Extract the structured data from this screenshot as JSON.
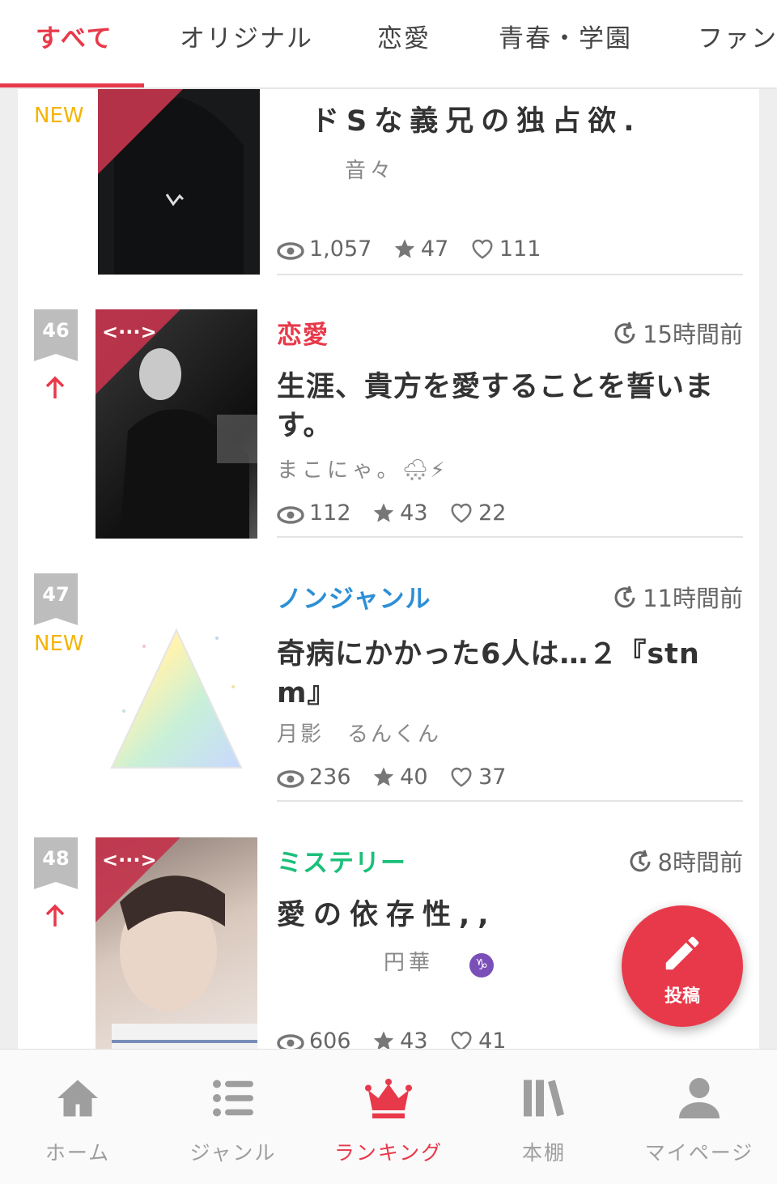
{
  "tabs": [
    "すべて",
    "オリジナル",
    "恋愛",
    "青春・学園",
    "ファン"
  ],
  "active_tab": "すべて",
  "colors": {
    "accent": "#e8394a",
    "new_badge": "#f5b400",
    "rank_badge": "#bdbdbd",
    "genre_romance": "#e8394a",
    "genre_nongenre": "#2d8fd6",
    "genre_mystery": "#1bbf7a"
  },
  "entries": [
    {
      "rank_status": "NEW",
      "title": "ドSな義兄の独占欲.",
      "author": "音々",
      "views": "1,057",
      "stars": "47",
      "likes": "111"
    },
    {
      "rank": "46",
      "rank_status": "up",
      "genre": "恋愛",
      "updated": "15時間前",
      "title": "生涯、貴方を愛することを誓います。",
      "author": "まこにゃ。",
      "author_emoji": "🌨⚡",
      "views": "112",
      "stars": "43",
      "likes": "22"
    },
    {
      "rank": "47",
      "rank_status": "NEW",
      "genre": "ノンジャンル",
      "updated": "11時間前",
      "title": "奇病にかかった6人は…２『stnm』",
      "author": "月影　るんくん",
      "views": "236",
      "stars": "40",
      "likes": "37"
    },
    {
      "rank": "48",
      "rank_status": "up",
      "genre": "ミステリー",
      "updated": "8時間前",
      "title": "愛の依存性,,",
      "author": "円華",
      "author_emoji": "♑",
      "views": "606",
      "stars": "43",
      "likes": "41"
    }
  ],
  "fab": {
    "label": "投稿",
    "icon": "pencil-icon"
  },
  "bottom_nav": [
    {
      "label": "ホーム",
      "icon": "home-icon"
    },
    {
      "label": "ジャンル",
      "icon": "list-icon"
    },
    {
      "label": "ランキング",
      "icon": "crown-icon",
      "active": true
    },
    {
      "label": "本棚",
      "icon": "bookshelf-icon"
    },
    {
      "label": "マイページ",
      "icon": "person-icon"
    }
  ]
}
